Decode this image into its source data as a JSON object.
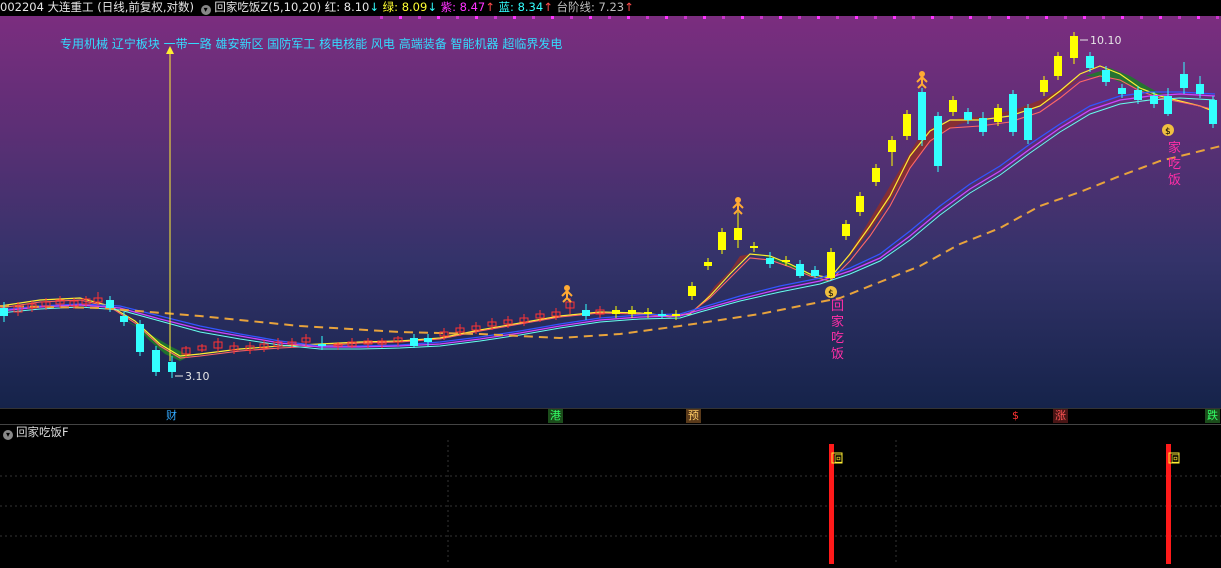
{
  "header": {
    "code": "002204",
    "name": "大连重工",
    "mode": "(日线,前复权,对数)",
    "indicator": "回家吃饭Z(5,10,20)",
    "red_label": "红: 8.10",
    "red_arrow": "↓",
    "green_label": "绿: 8.09",
    "green_arrow": "↓",
    "purple_label": "紫: 8.47",
    "purple_arrow": "↑",
    "blue_label": "蓝: 8.34",
    "blue_arrow": "↑",
    "step_label": "台阶线: 7.23",
    "step_arrow": "↑"
  },
  "tags": "专用机械 辽宁板块 一带一路 雄安新区 国防军工 核电核能 风电 高端装备 智能机器 超临界发电",
  "price_labels": {
    "high": "10.10",
    "low": "3.10"
  },
  "signal_text": {
    "first": [
      "回",
      "家",
      "吃",
      "饭"
    ],
    "second": [
      "家",
      "吃",
      "饭"
    ]
  },
  "signals": [
    {
      "label": "财",
      "color": "#33aaff"
    },
    {
      "label": "港",
      "color": "#33ff66"
    },
    {
      "label": "预",
      "color": "#ffcc66"
    },
    {
      "label": "$",
      "color": "#ff3333"
    },
    {
      "label": "涨",
      "color": "#ff5555"
    },
    {
      "label": "跌",
      "color": "#33ff66"
    }
  ],
  "sub_header": {
    "title": "回家吃饭F"
  },
  "sub_markers": [
    "回",
    "回"
  ],
  "colors": {
    "up": "#ff3333",
    "down": "#33ffff",
    "yellow": "#ffff00",
    "step": "#e8a33c"
  }
}
